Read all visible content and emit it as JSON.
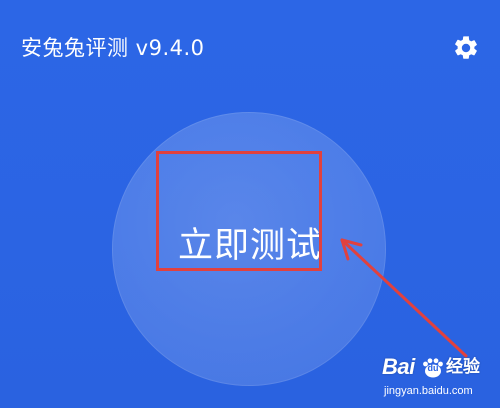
{
  "header": {
    "app_title": "安兔兔评测 v9.4.0",
    "settings_icon": "gear-icon"
  },
  "main": {
    "start_button_label": "立即测试"
  },
  "annotation": {
    "highlight_color": "#e1413e",
    "arrow_color": "#e1413e"
  },
  "watermark": {
    "brand": "Bai",
    "brand_mark": "du",
    "product": "经验",
    "url": "jingyan.baidu.com"
  },
  "colors": {
    "background": "#2c66e6",
    "text": "#ffffff"
  }
}
